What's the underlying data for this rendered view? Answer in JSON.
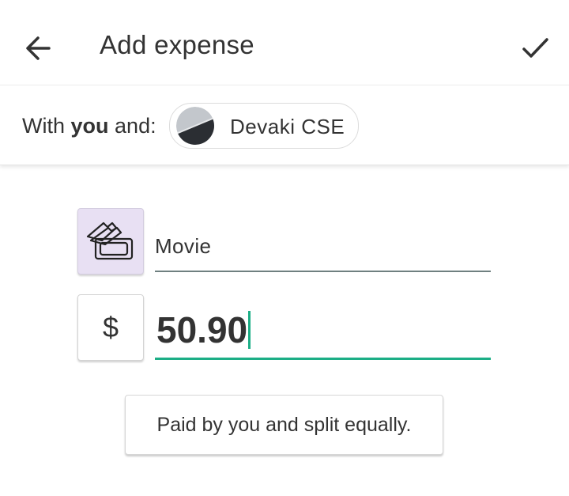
{
  "header": {
    "title": "Add expense",
    "back_icon": "arrow-left-icon",
    "save_icon": "check-icon"
  },
  "participants": {
    "prefix": "With ",
    "you": "you",
    "suffix": " and:",
    "chip_name": "Devaki CSE",
    "avatar_colors": [
      "#c3c7cc",
      "#2b2e33"
    ]
  },
  "expense": {
    "category_icon": "tickets-icon",
    "category_bg": "#e8e0f3",
    "description": "Movie",
    "currency_symbol": "$",
    "amount": "50.90"
  },
  "split": {
    "label": "Paid by you and split equally."
  },
  "colors": {
    "accent": "#1cae86",
    "text": "#333333"
  }
}
